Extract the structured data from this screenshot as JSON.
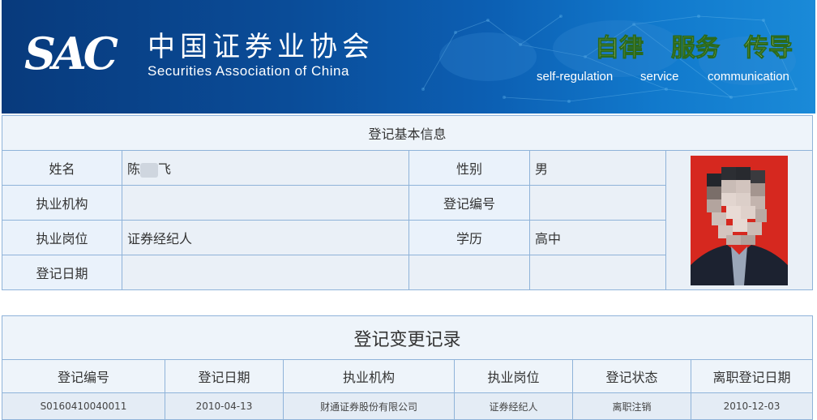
{
  "header": {
    "logo_mark": "SAC",
    "org_name_cn": "中国证券业协会",
    "org_name_en": "Securities Association of China",
    "slogans": [
      {
        "cn": "自律",
        "en": "self-regulation"
      },
      {
        "cn": "服务",
        "en": "service"
      },
      {
        "cn": "传导",
        "en": "communication"
      }
    ],
    "slogan_color": "#f4ef9a",
    "banner_color": "#0a4c98"
  },
  "basic_info": {
    "title": "登记基本信息",
    "name_label": "姓名",
    "name_first": "陈",
    "name_last": "飞",
    "gender_label": "性别",
    "gender_value": "男",
    "institution_label": "执业机构",
    "institution_value": "",
    "reg_no_label": "登记编号",
    "reg_no_value": "",
    "position_label": "执业岗位",
    "position_value": "证券经纪人",
    "education_label": "学历",
    "education_value": "高中",
    "reg_date_label": "登记日期",
    "reg_date_value": "",
    "photo_bg_color": "#d6281f"
  },
  "change_records": {
    "title": "登记变更记录",
    "columns": [
      "登记编号",
      "登记日期",
      "执业机构",
      "执业岗位",
      "登记状态",
      "离职登记日期"
    ],
    "rows": [
      [
        "S0160410040011",
        "2010-04-13",
        "财通证券股份有限公司",
        "证券经纪人",
        "离职注销",
        "2010-12-03"
      ]
    ]
  }
}
